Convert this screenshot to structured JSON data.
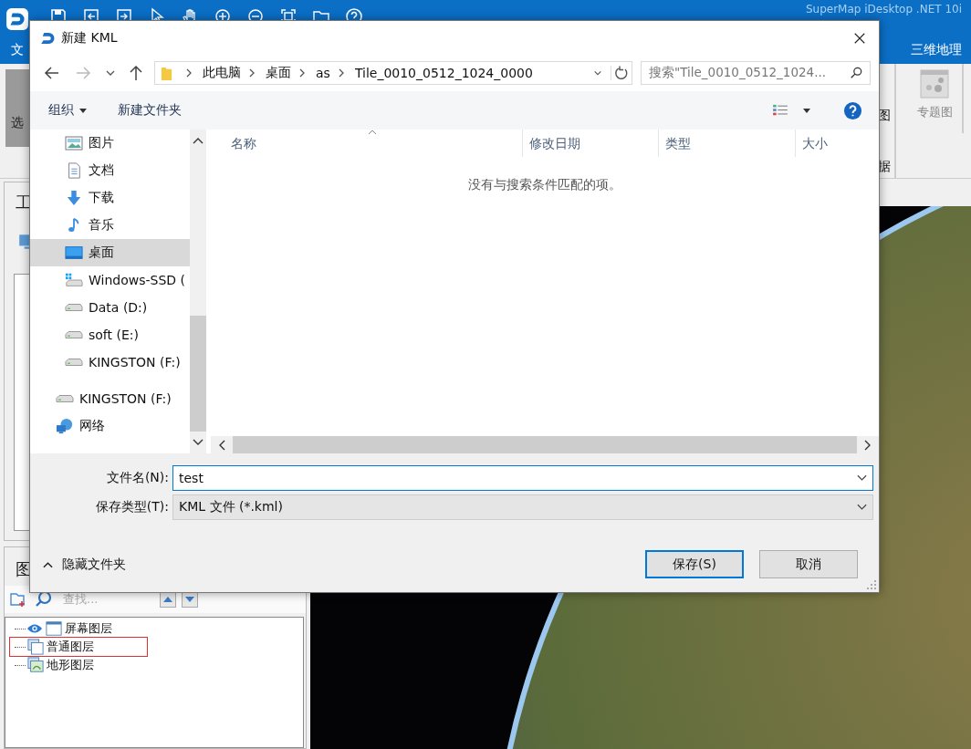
{
  "app": {
    "title": "SuperMap iDesktop .NET 10i",
    "menu": [
      "文",
      "三维地理"
    ],
    "ribbon_left_label": "选",
    "ribbon_right": [
      "图",
      "专题图",
      "据"
    ],
    "workspace_title": "工"
  },
  "layers_panel": {
    "title": "图",
    "search_placeholder": "查找...",
    "layers": [
      {
        "name": "屏幕图层",
        "kind": "screen",
        "visible": true,
        "highlighted": false
      },
      {
        "name": "普通图层",
        "kind": "normal",
        "visible": false,
        "highlighted": true
      },
      {
        "name": "地形图层",
        "kind": "terrain",
        "visible": false,
        "highlighted": false
      }
    ]
  },
  "dialog": {
    "title": "新建 KML",
    "breadcrumb": [
      "此电脑",
      "桌面",
      "as",
      "Tile_0010_0512_1024_0000"
    ],
    "search_placeholder": "搜索\"Tile_0010_0512_1024...",
    "organize": "组织",
    "new_folder": "新建文件夹",
    "nav_tree": [
      {
        "children": [
          {
            "label": "图片",
            "kind": "pictures",
            "selected": false
          },
          {
            "label": "文档",
            "kind": "documents",
            "selected": false
          },
          {
            "label": "下载",
            "kind": "download",
            "selected": false
          },
          {
            "label": "音乐",
            "kind": "music",
            "selected": false
          },
          {
            "label": "桌面",
            "kind": "desktop",
            "selected": true
          },
          {
            "label": "Windows-SSD (",
            "kind": "windows",
            "selected": false
          },
          {
            "label": "Data (D:)",
            "kind": "drive",
            "selected": false
          },
          {
            "label": "soft (E:)",
            "kind": "drive",
            "selected": false
          },
          {
            "label": "KINGSTON (F:)",
            "kind": "drive",
            "selected": false
          }
        ]
      },
      {
        "label": "KINGSTON (F:)",
        "kind": "drive",
        "selected": false
      },
      {
        "label": "网络",
        "kind": "network",
        "selected": false
      }
    ],
    "columns": [
      "名称",
      "修改日期",
      "类型",
      "大小"
    ],
    "empty_message": "没有与搜索条件匹配的项。",
    "file_name": {
      "label": "文件名(N):",
      "value": "test"
    },
    "file_type": {
      "label": "保存类型(T):",
      "value": "KML 文件 (*.kml)"
    },
    "hide_folders": "隐藏文件夹",
    "buttons": [
      {
        "label": "保存(S)",
        "kind": "primary"
      },
      {
        "label": "取消",
        "kind": "normal"
      }
    ]
  }
}
